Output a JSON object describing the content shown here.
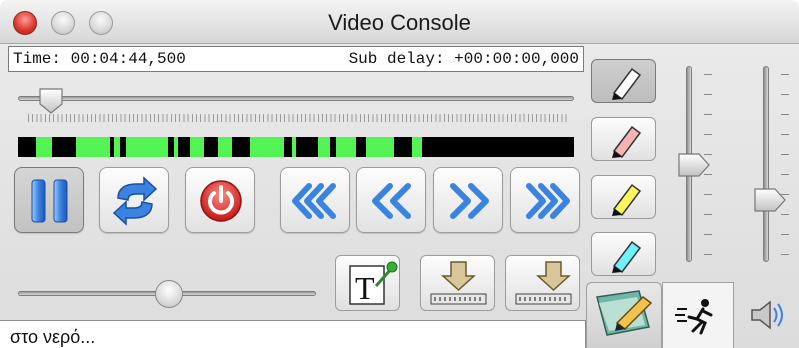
{
  "window": {
    "title": "Video Console"
  },
  "timebar": {
    "time_label": "Time: 00:04:44,500",
    "subdelay_label": "Sub delay: +00:00:00,000"
  },
  "position_slider": {
    "value_fraction": 0.06
  },
  "volume_slider": {
    "value_fraction": 0.53
  },
  "right_sliders": [
    {
      "name": "slider-1",
      "value_fraction": 0.55
    },
    {
      "name": "slider-2",
      "value_fraction": 0.35
    }
  ],
  "transport": {
    "buttons": [
      "pause",
      "loop",
      "power",
      "fast-backward",
      "backward",
      "forward",
      "fast-forward"
    ]
  },
  "highlighters": [
    {
      "color": "#ffffff"
    },
    {
      "color": "#f7b3b3"
    },
    {
      "color": "#fff55a"
    },
    {
      "color": "#6ff0ff"
    }
  ],
  "subtitle": {
    "current_text": "στο νερό..."
  },
  "colors": {
    "activity_bar": "#54f354",
    "button_blue": "#3a83e0",
    "power_red": "#e03131"
  },
  "tabs": [
    "edit-tab",
    "running-man-tab",
    "sound-tab"
  ]
}
